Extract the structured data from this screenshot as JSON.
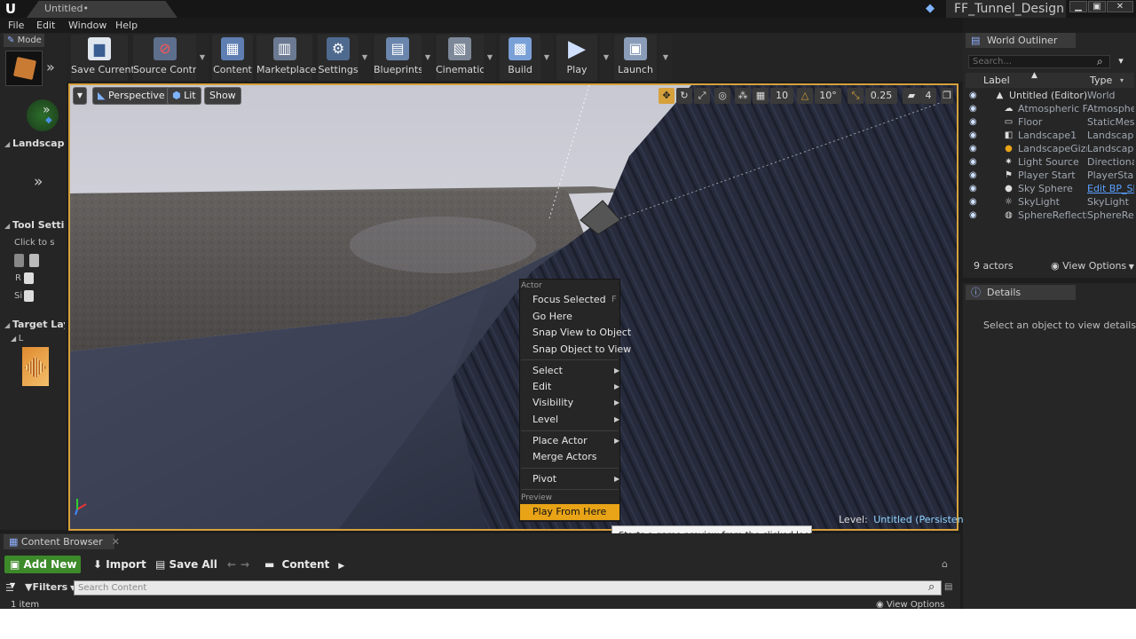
{
  "titlebar": {
    "tab_title": "Untitled•",
    "project_name": "FF_Tunnel_Design",
    "minimize_glyph": "▁",
    "maximize_glyph": "▣",
    "close_glyph": "✕"
  },
  "menu": [
    "File",
    "Edit",
    "Window",
    "Help"
  ],
  "modes": {
    "tab_label": "Mode",
    "landscape_title": "Landscape",
    "tool_settings_title": "Tool Setting",
    "click_to_text": "Click to s",
    "row_r": "R",
    "row_s": "Si",
    "target_layers_title": "Target Laye",
    "layer_letter": "L"
  },
  "toolbar": {
    "buttons": [
      {
        "label": "Save Current",
        "icon": "save-icon"
      },
      {
        "label": "Source Control",
        "icon": "source-control-icon"
      },
      {
        "label": "Content",
        "icon": "content-icon"
      },
      {
        "label": "Marketplace",
        "icon": "marketplace-icon"
      },
      {
        "label": "Settings",
        "icon": "settings-icon"
      },
      {
        "label": "Blueprints",
        "icon": "blueprints-icon"
      },
      {
        "label": "Cinematics",
        "icon": "cinematics-icon"
      },
      {
        "label": "Build",
        "icon": "build-icon"
      },
      {
        "label": "Play",
        "icon": "play-icon"
      },
      {
        "label": "Launch",
        "icon": "launch-icon"
      }
    ]
  },
  "viewport": {
    "perspective_label": "Perspective",
    "lit_label": "Lit",
    "show_label": "Show",
    "grid_snap": "10",
    "rotation_snap": "10°",
    "scale_snap": "0.25",
    "camera_speed": "4",
    "level_prefix": "Level:",
    "level_name": "Untitled (Persistent)"
  },
  "context_menu": {
    "actor_heading": "Actor",
    "focus_selected": "Focus Selected",
    "focus_shortcut": "F",
    "go_here": "Go Here",
    "snap_view_to_object": "Snap View to Object",
    "snap_object_to_view": "Snap Object to View",
    "select": "Select",
    "edit": "Edit",
    "visibility": "Visibility",
    "level": "Level",
    "place_actor": "Place Actor",
    "merge_actors": "Merge Actors",
    "pivot": "Pivot",
    "preview_heading": "Preview",
    "play_from_here": "Play From Here",
    "tooltip": "Starts a game preview from the clicked location"
  },
  "outliner": {
    "tab_title": "World Outliner",
    "search_placeholder": "Search...",
    "col_label": "Label",
    "col_type": "Type",
    "rows": [
      {
        "label": "Untitled (Editor)",
        "type": "World"
      },
      {
        "label": "Atmospheric Fog",
        "type": "AtmosphericFog"
      },
      {
        "label": "Floor",
        "type": "StaticMeshActor"
      },
      {
        "label": "Landscape1",
        "type": "Landscape"
      },
      {
        "label": "LandscapeGizmoActiveActor",
        "type": "LandscapeGizmo"
      },
      {
        "label": "Light Source",
        "type": "DirectionalLight"
      },
      {
        "label": "Player Start",
        "type": "PlayerStart"
      },
      {
        "label": "Sky Sphere",
        "type": "Edit BP_Sky_Sphere"
      },
      {
        "label": "SkyLight",
        "type": "SkyLight"
      },
      {
        "label": "SphereReflectionCapture",
        "type": "SphereReflectionCapture"
      }
    ],
    "actor_count": "9 actors",
    "view_options": "View Options"
  },
  "details": {
    "tab_title": "Details",
    "empty_message": "Select an object to view details."
  },
  "content_browser": {
    "tab_title": "Content Browser",
    "add_new": "Add New",
    "import": "Import",
    "save_all": "Save All",
    "path": "Content",
    "filters": "Filters",
    "search_placeholder": "Search Content",
    "item_count": "1 item",
    "view_options": "View Options"
  }
}
